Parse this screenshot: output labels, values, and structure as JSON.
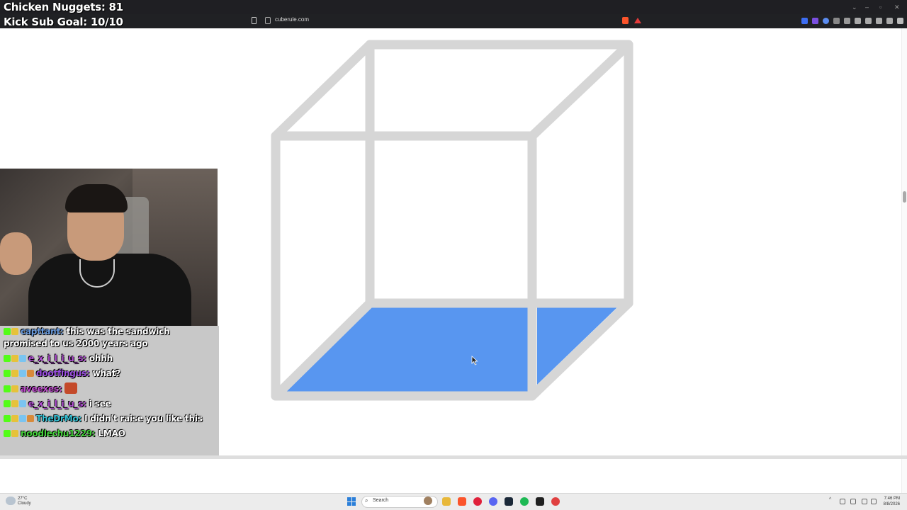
{
  "overlay": {
    "line1": "Chicken Nuggets: 81",
    "line2": "Kick Sub Goal: 10/10"
  },
  "browser": {
    "url": "cuberule.com"
  },
  "cube": {
    "edge_color": "#d6d6d6",
    "fill_color": "#5896f0"
  },
  "chat": {
    "messages": [
      {
        "user": "capttant",
        "user_color": "#6a9ce0",
        "text": "this was the sandwich promised to us 2000 years ago"
      },
      {
        "user": "e_x_i_l_i_u_s",
        "user_color": "#b44fd6",
        "text": "ohhh"
      },
      {
        "user": "dootfingus",
        "user_color": "#9b4fe0",
        "text": "what?"
      },
      {
        "user": "aveexes",
        "user_color": "#c24fd0",
        "text": ""
      },
      {
        "user": "e_x_i_l_i_u_s",
        "user_color": "#b44fd6",
        "text": "i see"
      },
      {
        "user": "TheDrMo",
        "user_color": "#39c3d6",
        "text": "I didn't raise you like this"
      },
      {
        "user": "noodlechu1229",
        "user_color": "#45d13c",
        "text": "LMAO"
      }
    ]
  },
  "taskbar": {
    "weather_temp": "27°C",
    "weather_desc": "Cloudy",
    "search_label": "Search",
    "time": "7:46 PM",
    "date": "8/8/2026"
  }
}
